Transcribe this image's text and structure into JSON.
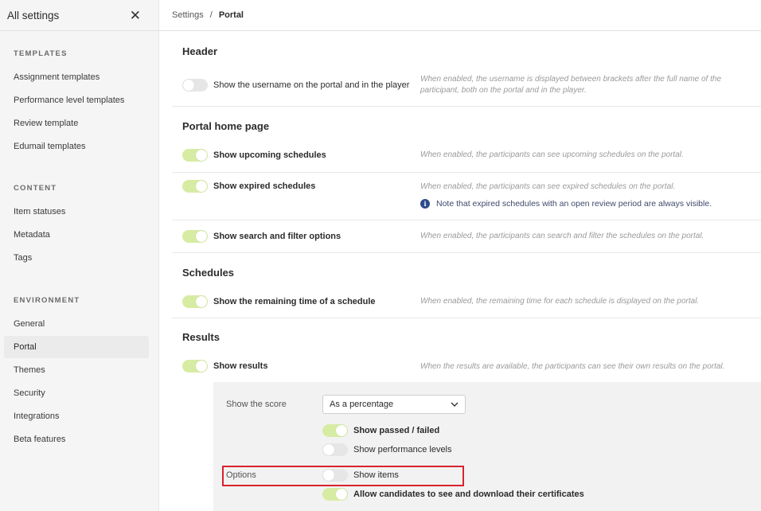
{
  "sidebar": {
    "title": "All settings",
    "close_icon": "close-icon",
    "sections": [
      {
        "label": "TEMPLATES",
        "items": [
          "Assignment templates",
          "Performance level templates",
          "Review template",
          "Edumail templates"
        ]
      },
      {
        "label": "CONTENT",
        "items": [
          "Item statuses",
          "Metadata",
          "Tags"
        ]
      },
      {
        "label": "ENVIRONMENT",
        "items": [
          "General",
          "Portal",
          "Themes",
          "Security",
          "Integrations",
          "Beta features"
        ]
      }
    ],
    "active_item": "Portal"
  },
  "breadcrumb": {
    "parent": "Settings",
    "separator": "/",
    "current": "Portal"
  },
  "sections": {
    "header": {
      "title": "Header",
      "settings": [
        {
          "label": "Show the username on the portal and in the player",
          "enabled": false,
          "description": "When enabled, the username is displayed between brackets after the full name of the participant, both on the portal and in the player."
        }
      ]
    },
    "portal_home": {
      "title": "Portal home page",
      "settings": [
        {
          "label": "Show upcoming schedules",
          "enabled": true,
          "description": "When enabled, the participants can see upcoming schedules on the portal."
        },
        {
          "label": "Show expired schedules",
          "enabled": true,
          "description": "When enabled, the participants can see expired schedules on the portal.",
          "note": "Note that expired schedules with an open review period are always visible."
        },
        {
          "label": "Show search and filter options",
          "enabled": true,
          "description": "When enabled, the participants can search and filter the schedules on the portal."
        }
      ]
    },
    "schedules": {
      "title": "Schedules",
      "settings": [
        {
          "label": "Show the remaining time of a schedule",
          "enabled": true,
          "description": "When enabled, the remaining time for each schedule is displayed on the portal."
        }
      ]
    },
    "results": {
      "title": "Results",
      "settings": [
        {
          "label": "Show results",
          "enabled": true,
          "description": "When the results are available, the participants can see their own results on the portal."
        }
      ],
      "panel": {
        "score_label": "Show the score",
        "score_value": "As a percentage",
        "options_label": "Options",
        "options": [
          {
            "label": "Show passed / failed",
            "enabled": true
          },
          {
            "label": "Show performance levels",
            "enabled": false
          },
          {
            "label": "Show items",
            "enabled": false
          },
          {
            "label": "Allow candidates to see and download their certificates",
            "enabled": true
          }
        ]
      }
    }
  },
  "colors": {
    "toggle_on": "#d7eca3",
    "toggle_off": "#e6e6e6",
    "highlight": "#d9232e",
    "info_icon": "#2d4a8a"
  }
}
